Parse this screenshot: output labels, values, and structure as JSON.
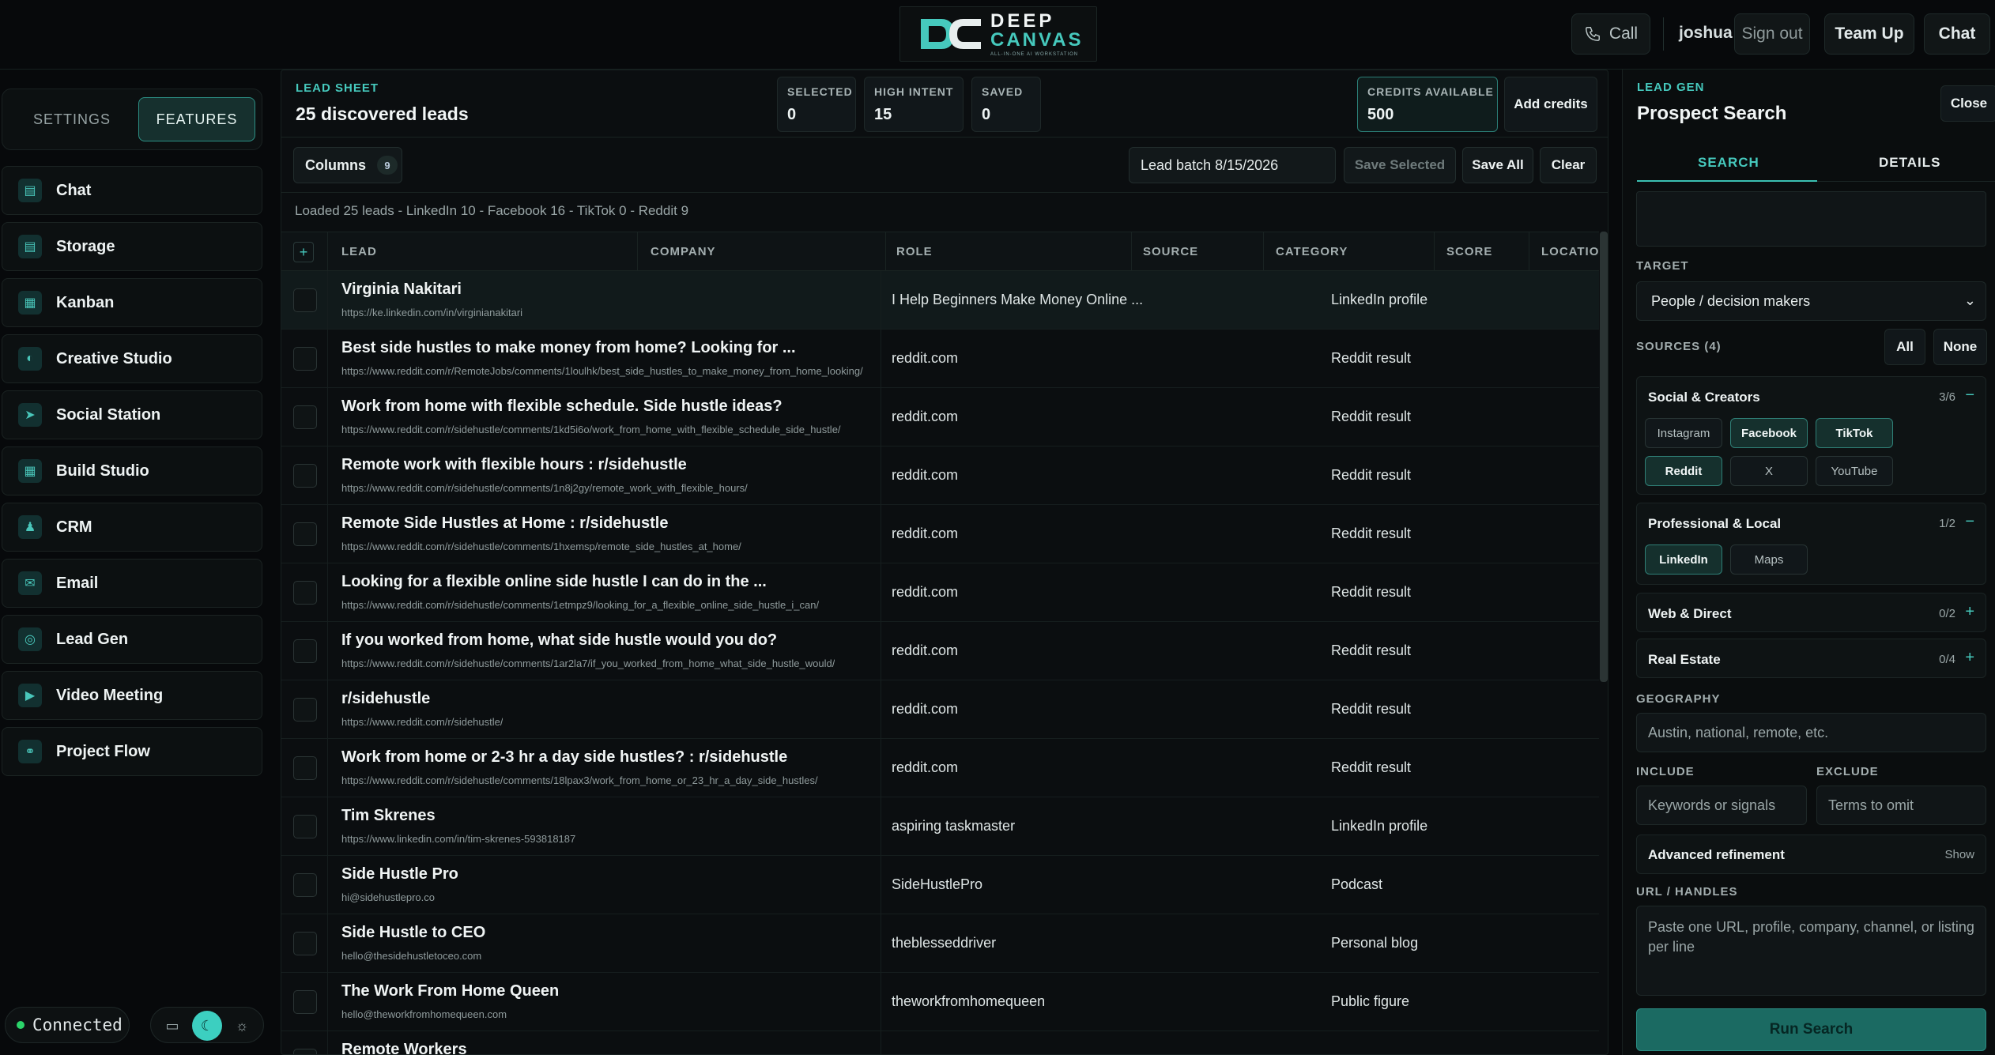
{
  "header": {
    "logo_line1": "DEEP",
    "logo_line2": "CANVAS",
    "logo_tagline": "ALL-IN-ONE AI WORKSTATION",
    "call_label": "Call",
    "username": "joshua",
    "signout_label": "Sign out",
    "teamup_label": "Team Up",
    "chat_label": "Chat"
  },
  "sidebar": {
    "tab_settings": "SETTINGS",
    "tab_features": "FEATURES",
    "items": [
      {
        "label": "Chat",
        "icon": "chat-icon",
        "glyph": "▤"
      },
      {
        "label": "Storage",
        "icon": "storage-icon",
        "glyph": "▤"
      },
      {
        "label": "Kanban",
        "icon": "kanban-icon",
        "glyph": "▦"
      },
      {
        "label": "Creative Studio",
        "icon": "palette-icon",
        "glyph": "◐"
      },
      {
        "label": "Social Station",
        "icon": "send-icon",
        "glyph": "➤"
      },
      {
        "label": "Build Studio",
        "icon": "grid-icon",
        "glyph": "▦"
      },
      {
        "label": "CRM",
        "icon": "users-icon",
        "glyph": "♟"
      },
      {
        "label": "Email",
        "icon": "mail-icon",
        "glyph": "✉"
      },
      {
        "label": "Lead Gen",
        "icon": "target-icon",
        "glyph": "◎"
      },
      {
        "label": "Video Meeting",
        "icon": "video-icon",
        "glyph": "▶"
      },
      {
        "label": "Project Flow",
        "icon": "flow-icon",
        "glyph": "⚭"
      }
    ],
    "status": "Connected",
    "theme": {
      "desktop_glyph": "▭",
      "moon_glyph": "☾",
      "sun_glyph": "☼"
    }
  },
  "sheet": {
    "kicker": "LEAD SHEET",
    "title": "25 discovered leads",
    "stats": {
      "selected_label": "SELECTED",
      "selected_value": "0",
      "high_intent_label": "HIGH INTENT",
      "high_intent_value": "15",
      "saved_label": "SAVED",
      "saved_value": "0",
      "credits_label": "CREDITS AVAILABLE",
      "credits_value": "500"
    },
    "add_credits_label": "Add credits",
    "columns_label": "Columns",
    "columns_count": "9",
    "batch_name": "Lead batch 8/15/2026",
    "save_selected_label": "Save Selected",
    "save_all_label": "Save All",
    "clear_label": "Clear",
    "loaded_text": "Loaded 25 leads - LinkedIn 10 - Facebook 16 - TikTok 0 - Reddit 9",
    "add_column_glyph": "+",
    "columns": [
      "LEAD",
      "COMPANY",
      "ROLE",
      "SOURCE",
      "CATEGORY",
      "SCORE",
      "LOCATION"
    ],
    "rows": [
      {
        "title": "Virginia Nakitari",
        "url": "https://ke.linkedin.com/in/virginianakitari",
        "company": "I Help Beginners Make Money Online ...",
        "category": "LinkedIn profile"
      },
      {
        "title": "Best side hustles to make money from home? Looking for ...",
        "url": "https://www.reddit.com/r/RemoteJobs/comments/1loulhk/best_side_hustles_to_make_money_from_home_looking/",
        "company": "reddit.com",
        "category": "Reddit result"
      },
      {
        "title": "Work from home with flexible schedule. Side hustle ideas?",
        "url": "https://www.reddit.com/r/sidehustle/comments/1kd5i6o/work_from_home_with_flexible_schedule_side_hustle/",
        "company": "reddit.com",
        "category": "Reddit result"
      },
      {
        "title": "Remote work with flexible hours : r/sidehustle",
        "url": "https://www.reddit.com/r/sidehustle/comments/1n8j2gy/remote_work_with_flexible_hours/",
        "company": "reddit.com",
        "category": "Reddit result"
      },
      {
        "title": "Remote Side Hustles at Home : r/sidehustle",
        "url": "https://www.reddit.com/r/sidehustle/comments/1hxemsp/remote_side_hustles_at_home/",
        "company": "reddit.com",
        "category": "Reddit result"
      },
      {
        "title": "Looking for a flexible online side hustle I can do in the ...",
        "url": "https://www.reddit.com/r/sidehustle/comments/1etmpz9/looking_for_a_flexible_online_side_hustle_i_can/",
        "company": "reddit.com",
        "category": "Reddit result"
      },
      {
        "title": "If you worked from home, what side hustle would you do?",
        "url": "https://www.reddit.com/r/sidehustle/comments/1ar2la7/if_you_worked_from_home_what_side_hustle_would/",
        "company": "reddit.com",
        "category": "Reddit result"
      },
      {
        "title": "r/sidehustle",
        "url": "https://www.reddit.com/r/sidehustle/",
        "company": "reddit.com",
        "category": "Reddit result"
      },
      {
        "title": "Work from home or 2-3 hr a day side hustles? : r/sidehustle",
        "url": "https://www.reddit.com/r/sidehustle/comments/18lpax3/work_from_home_or_23_hr_a_day_side_hustles/",
        "company": "reddit.com",
        "category": "Reddit result"
      },
      {
        "title": "Tim Skrenes",
        "url": "https://www.linkedin.com/in/tim-skrenes-593818187",
        "company": "aspiring taskmaster",
        "category": "LinkedIn profile"
      },
      {
        "title": "Side Hustle Pro",
        "url": "hi@sidehustlepro.co",
        "company": "SideHustlePro",
        "category": "Podcast"
      },
      {
        "title": "Side Hustle to CEO",
        "url": "hello@thesidehustletoceo.com",
        "company": "theblesseddriver",
        "category": "Personal blog"
      },
      {
        "title": "The Work From Home Queen",
        "url": "hello@theworkfromhomequeen.com",
        "company": "theworkfromhomequeen",
        "category": "Public figure"
      },
      {
        "title": "Remote Workers",
        "url": "",
        "company": "",
        "category": ""
      }
    ]
  },
  "prospect": {
    "kicker": "LEAD GEN",
    "title": "Prospect Search",
    "close_label": "Close",
    "tab_search": "SEARCH",
    "tab_details": "DETAILS",
    "target_label": "TARGET",
    "target_value": "People / decision makers",
    "sources_label": "SOURCES (4)",
    "all_label": "All",
    "none_label": "None",
    "groups": {
      "social": {
        "title": "Social & Creators",
        "count": "3/6",
        "toggle": "−",
        "chips": [
          {
            "label": "Instagram",
            "on": false
          },
          {
            "label": "Facebook",
            "on": true
          },
          {
            "label": "TikTok",
            "on": true
          },
          {
            "label": "Reddit",
            "on": true
          },
          {
            "label": "X",
            "on": false
          },
          {
            "label": "YouTube",
            "on": false
          }
        ]
      },
      "professional": {
        "title": "Professional & Local",
        "count": "1/2",
        "toggle": "−",
        "chips": [
          {
            "label": "LinkedIn",
            "on": true
          },
          {
            "label": "Maps",
            "on": false
          }
        ]
      },
      "web": {
        "title": "Web & Direct",
        "count": "0/2",
        "toggle": "+"
      },
      "realestate": {
        "title": "Real Estate",
        "count": "0/4",
        "toggle": "+"
      }
    },
    "geography_label": "GEOGRAPHY",
    "geography_placeholder": "Austin, national, remote, etc.",
    "include_label": "INCLUDE",
    "include_placeholder": "Keywords or signals",
    "exclude_label": "EXCLUDE",
    "exclude_placeholder": "Terms to omit",
    "advanced_label": "Advanced refinement",
    "advanced_show": "Show",
    "url_label": "URL / HANDLES",
    "url_placeholder": "Paste one URL, profile, company, channel, or listing per line",
    "run_label": "Run Search"
  }
}
